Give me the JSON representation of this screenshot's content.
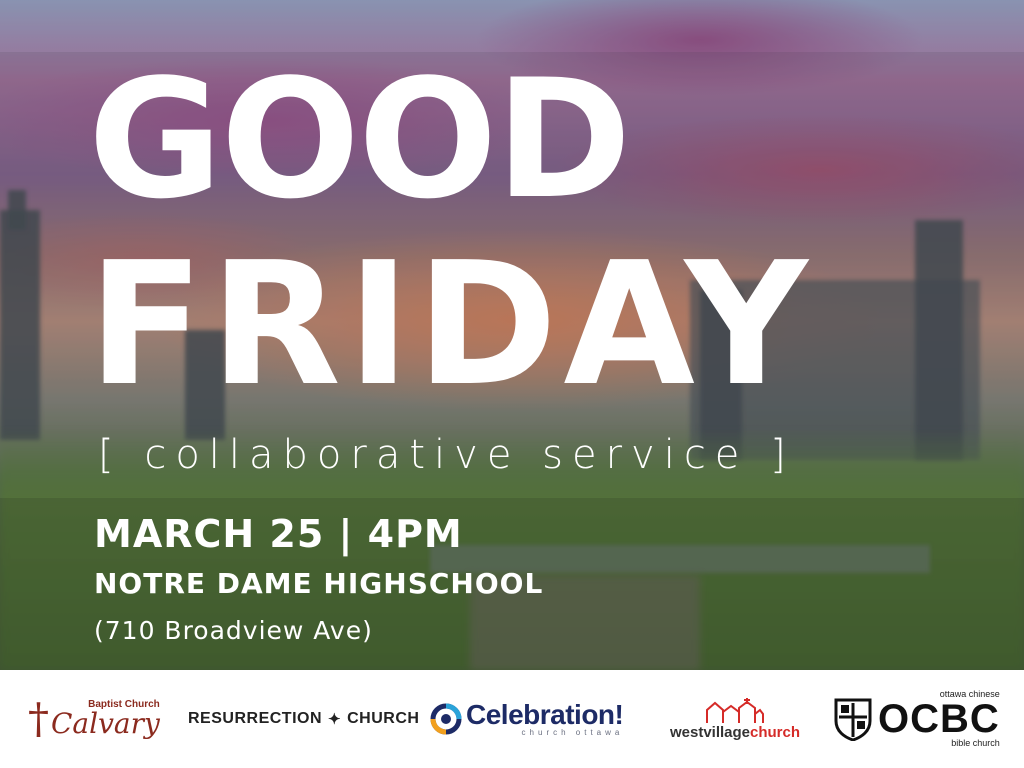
{
  "poster": {
    "title_line1": "GOOD",
    "title_line2": "FRIDAY",
    "subtitle": "[ collaborative service ]",
    "date_time": "MARCH 25 | 4PM",
    "venue": "NOTRE DAME HIGHSCHOOL",
    "address": "(710 Broadview Ave)"
  },
  "logos": {
    "calvary": {
      "top": "Baptist Church",
      "name": "Calvary"
    },
    "resurrection": {
      "left": "RESURRECTION",
      "right": "CHURCH"
    },
    "celebration": {
      "name": "Celebration!",
      "tagline": "church ottawa"
    },
    "westvillage": {
      "part1": "westvillage",
      "part2": "church"
    },
    "ocbc": {
      "top": "ottawa chinese",
      "name": "OCBC",
      "bottom": "bible church"
    }
  },
  "colors": {
    "headline": "#ffffff",
    "calvary": "#8b2a1e",
    "celebration": "#1d2b66",
    "westvillage_accent": "#d52b28"
  }
}
